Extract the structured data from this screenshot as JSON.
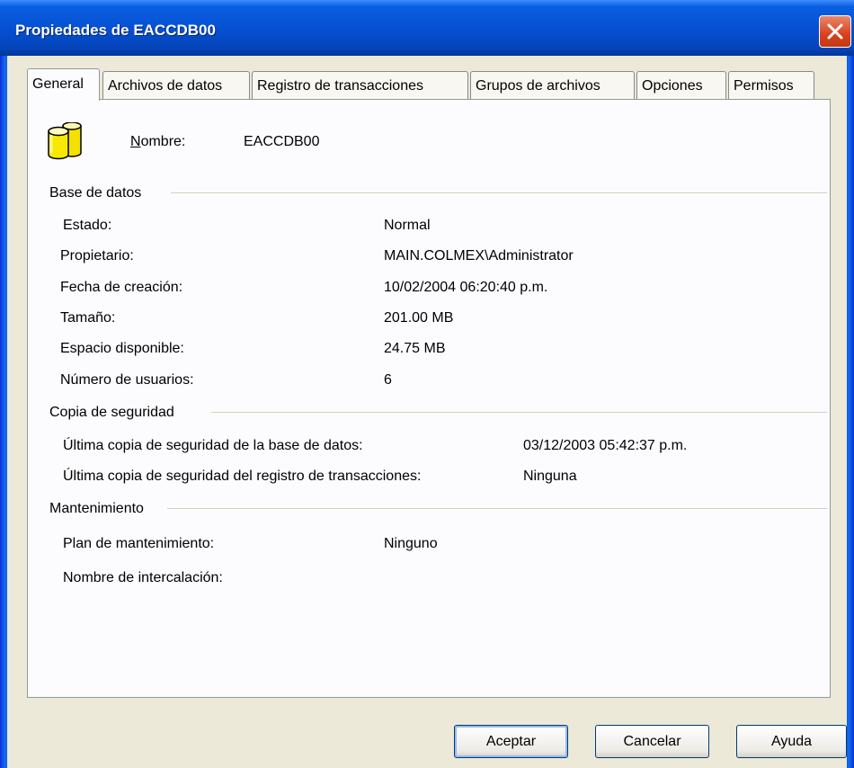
{
  "window": {
    "title": "Propiedades de EACCDB00"
  },
  "tabs": [
    "General",
    "Archivos de datos",
    "Registro de transacciones",
    "Grupos de archivos",
    "Opciones",
    "Permisos"
  ],
  "name": {
    "label": "Nombre:",
    "value": "EACCDB00"
  },
  "sections": {
    "database": {
      "title": "Base de datos",
      "rows": [
        {
          "label": "Estado:",
          "value": "Normal"
        },
        {
          "label": "Propietario:",
          "value": "MAIN.COLMEX\\Administrator"
        },
        {
          "label": "Fecha de creación:",
          "value": "10/02/2004 06:20:40 p.m."
        },
        {
          "label": "Tamaño:",
          "value": "201.00 MB"
        },
        {
          "label": "Espacio disponible:",
          "value": "24.75 MB"
        },
        {
          "label": "Número de usuarios:",
          "value": "6"
        }
      ]
    },
    "backup": {
      "title": "Copia de seguridad",
      "rows": [
        {
          "label": "Última copia de seguridad de la base de datos:",
          "value": "03/12/2003 05:42:37 p.m."
        },
        {
          "label": "Última copia de seguridad del registro de transacciones:",
          "value": "Ninguna"
        }
      ]
    },
    "maintenance": {
      "title": "Mantenimiento",
      "rows": [
        {
          "label": "Plan de mantenimiento:",
          "value": "Ninguno"
        },
        {
          "label": "Nombre de intercalación:",
          "value": ""
        }
      ]
    }
  },
  "buttons": {
    "ok": "Aceptar",
    "cancel": "Cancelar",
    "help": "Ayuda"
  },
  "colors": {
    "titlebar": "#0551d4",
    "dialog_bg": "#ece9d8",
    "panel_bg": "#fcfcfe"
  },
  "icons": {
    "database": "database-icon",
    "close": "close-icon"
  }
}
